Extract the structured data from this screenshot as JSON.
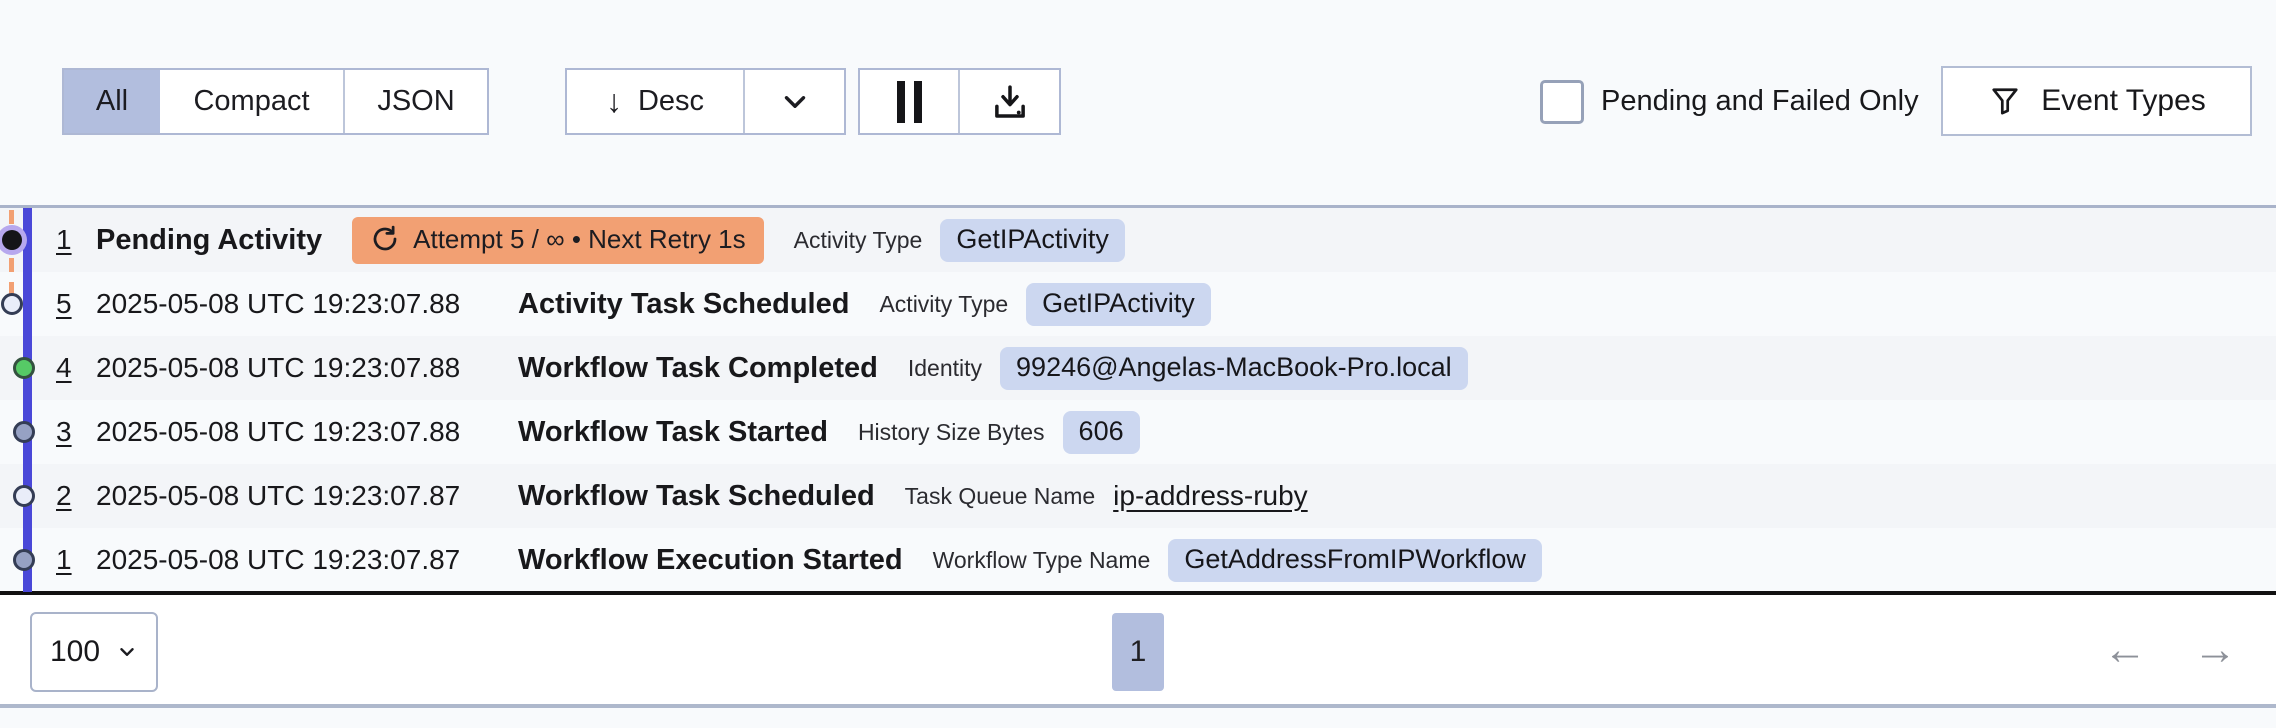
{
  "toolbar": {
    "view_tabs": [
      {
        "label": "All",
        "selected": true
      },
      {
        "label": "Compact",
        "selected": false
      },
      {
        "label": "JSON",
        "selected": false
      }
    ],
    "sort_label": "Desc",
    "pending_failed_label": "Pending and Failed Only",
    "event_types_label": "Event Types"
  },
  "icons": {
    "sort_desc": "↓",
    "chevron_down": "chevron-down",
    "pause": "pause",
    "download": "download",
    "filter": "funnel",
    "retry": "retry-circular-arrow",
    "prev_page": "←",
    "next_page": "→"
  },
  "events": [
    {
      "id": "1",
      "time": "",
      "name": "Pending Activity",
      "retry_badge": "Attempt 5 / ∞ • Next Retry 1s",
      "attr_label": "Activity Type",
      "attr_value": "GetIPActivity",
      "status": "pending"
    },
    {
      "id": "5",
      "time": "2025-05-08 UTC 19:23:07.88",
      "name": "Activity Task Scheduled",
      "attr_label": "Activity Type",
      "attr_value": "GetIPActivity",
      "status": "scheduled"
    },
    {
      "id": "4",
      "time": "2025-05-08 UTC 19:23:07.88",
      "name": "Workflow Task Completed",
      "attr_label": "Identity",
      "attr_value": "99246@Angelas-MacBook-Pro.local",
      "status": "completed"
    },
    {
      "id": "3",
      "time": "2025-05-08 UTC 19:23:07.88",
      "name": "Workflow Task Started",
      "attr_label": "History Size Bytes",
      "attr_value": "606",
      "status": "started"
    },
    {
      "id": "2",
      "time": "2025-05-08 UTC 19:23:07.87",
      "name": "Workflow Task Scheduled",
      "attr_label": "Task Queue Name",
      "attr_value": "ip-address-ruby",
      "attr_value_style": "link",
      "status": "scheduled"
    },
    {
      "id": "1",
      "time": "2025-05-08 UTC 19:23:07.87",
      "name": "Workflow Execution Started",
      "attr_label": "Workflow Type Name",
      "attr_value": "GetAddressFromIPWorkflow",
      "status": "started"
    }
  ],
  "pagination": {
    "page_size": "100",
    "current_page": "1"
  },
  "colors": {
    "accent_indigo_line": "#4a48d8",
    "pending_orange": "#f2a073",
    "badge_periwinkle": "#ccd7f0",
    "selected_lavender": "#b2bede",
    "completed_green": "#56ca66",
    "page_background": "#f8fafc"
  }
}
